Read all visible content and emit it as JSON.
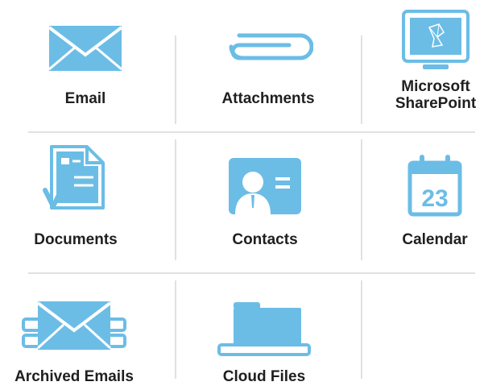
{
  "accent_color": "#6bbde6",
  "accent_dark": "#5aaedb",
  "divider_color": "#e1e1e1",
  "items": [
    {
      "label": "Email",
      "icon": "envelope-icon"
    },
    {
      "label": "Attachments",
      "icon": "paperclip-icon"
    },
    {
      "label_line1": "Microsoft",
      "label_line2": "SharePoint",
      "icon": "sharepoint-monitor-icon"
    },
    {
      "label": "Documents",
      "icon": "document-check-icon"
    },
    {
      "label": "Contacts",
      "icon": "contact-card-icon"
    },
    {
      "label": "Calendar",
      "icon": "calendar-icon",
      "calendar_day": "23"
    },
    {
      "label": "Archived Emails",
      "icon": "archived-envelope-icon"
    },
    {
      "label": "Cloud Files",
      "icon": "folder-icon"
    }
  ]
}
